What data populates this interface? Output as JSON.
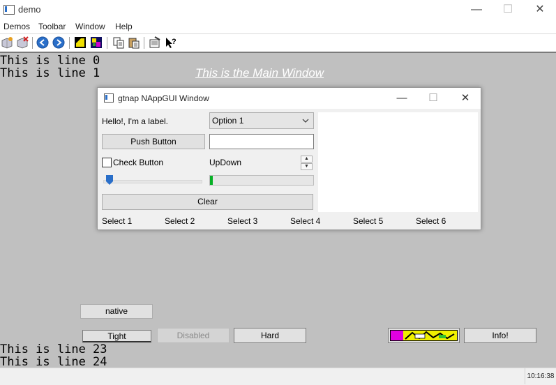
{
  "window": {
    "title": "demo",
    "minimize": "—",
    "maximize": "☐",
    "close": "✕"
  },
  "menu": [
    "Demos",
    "Toolbar",
    "Window",
    "Help"
  ],
  "toolbar": {
    "icons": [
      "new-file-icon",
      "delete-icon",
      "back-icon",
      "forward-icon",
      "note-icon",
      "image-icon",
      "copy-icon",
      "paste-icon",
      "properties-icon",
      "help-cursor-icon"
    ]
  },
  "main": {
    "lines_top": [
      "This is line 0",
      "This is line 1"
    ],
    "label": "This is the Main Window",
    "native_button": "native",
    "buttons": {
      "tight": "Tight",
      "disabled": "Disabled",
      "hard": "Hard",
      "info": "Info!"
    },
    "lines_bottom": [
      "This is line 23",
      "This is line 24"
    ]
  },
  "subwindow": {
    "title": "gtnap NAppGUI Window",
    "minimize": "—",
    "maximize": "☐",
    "close": "✕",
    "label": "Hello!, I'm a label.",
    "combo_value": "Option 1",
    "push_button": "Push Button",
    "edit_value": "",
    "check_label": "Check Button",
    "updown_label": "UpDown",
    "slider_value": 0.05,
    "progress_value": 0.03,
    "clear_button": "Clear",
    "selects": [
      "Select 1",
      "Select 2",
      "Select 3",
      "Select 4",
      "Select 5",
      "Select 6"
    ]
  },
  "status": {
    "time": "10:16:38"
  },
  "colors": {
    "main_bg": "#c0c0c0",
    "progress_fill": "#06b025",
    "slider_thumb": "#2a6fc9"
  }
}
